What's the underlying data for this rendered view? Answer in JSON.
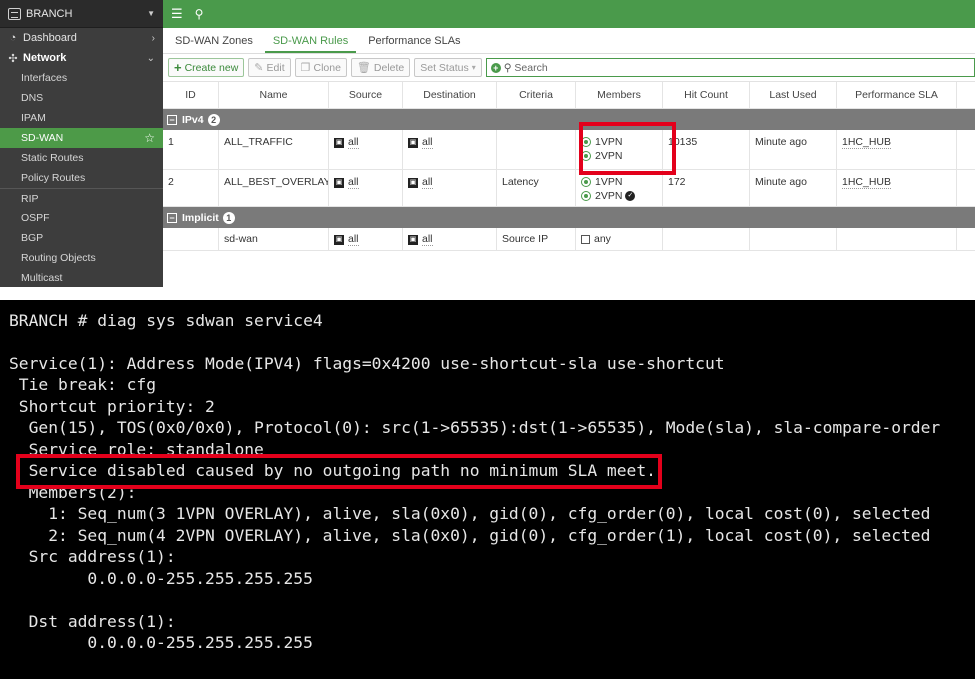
{
  "sidebar": {
    "device": "BRANCH",
    "items": [
      {
        "icon": "dashboard-icon",
        "label": "Dashboard"
      },
      {
        "icon": "network-icon",
        "label": "Network"
      }
    ],
    "network_sub": [
      "Interfaces",
      "DNS",
      "IPAM",
      "SD-WAN",
      "Static Routes",
      "Policy Routes",
      "RIP",
      "OSPF",
      "BGP",
      "Routing Objects",
      "Multicast"
    ]
  },
  "tabs": [
    "SD-WAN Zones",
    "SD-WAN Rules",
    "Performance SLAs"
  ],
  "toolbar": {
    "create": "Create new",
    "edit": "Edit",
    "clone": "Clone",
    "delete": "Delete",
    "set_status": "Set Status",
    "search_placeholder": "Search"
  },
  "table": {
    "headers": [
      "ID",
      "Name",
      "Source",
      "Destination",
      "Criteria",
      "Members",
      "Hit Count",
      "Last Used",
      "Performance SLA"
    ],
    "groups": [
      {
        "label": "IPv4",
        "count": "2"
      },
      {
        "label": "Implicit",
        "count": "1"
      }
    ],
    "rows": [
      {
        "id": "1",
        "name": "ALL_TRAFFIC",
        "source": "all",
        "destination": "all",
        "criteria": "",
        "members": [
          "1VPN",
          "2VPN"
        ],
        "hit": "10135",
        "last": "Minute ago",
        "sla": "1HC_HUB"
      },
      {
        "id": "2",
        "name": "ALL_BEST_OVERLAY",
        "source": "all",
        "destination": "all",
        "criteria": "Latency",
        "members": [
          "1VPN",
          "2VPN"
        ],
        "hit": "172",
        "last": "Minute ago",
        "sla": "1HC_HUB"
      },
      {
        "id": "",
        "name": "sd-wan",
        "source": "all",
        "destination": "all",
        "criteria": "Source IP",
        "members": [
          "any"
        ],
        "hit": "",
        "last": "",
        "sla": ""
      }
    ]
  },
  "terminal": {
    "lines": [
      "BRANCH # diag sys sdwan service4",
      "",
      "Service(1): Address Mode(IPV4) flags=0x4200 use-shortcut-sla use-shortcut",
      " Tie break: cfg",
      " Shortcut priority: 2",
      "  Gen(15), TOS(0x0/0x0), Protocol(0): src(1->65535):dst(1->65535), Mode(sla), sla-compare-order",
      "  Service role: standalone",
      "  Service disabled caused by no outgoing path no minimum SLA meet.",
      "  Members(2):",
      "    1: Seq_num(3 1VPN OVERLAY), alive, sla(0x0), gid(0), cfg_order(0), local cost(0), selected",
      "    2: Seq_num(4 2VPN OVERLAY), alive, sla(0x0), gid(0), cfg_order(1), local cost(0), selected",
      "  Src address(1):",
      "        0.0.0.0-255.255.255.255",
      "",
      "  Dst address(1):",
      "        0.0.0.0-255.255.255.255"
    ]
  },
  "colors": {
    "accent": "#4a9a4b",
    "highlight": "#e3001b",
    "sidebar": "#3d3d3d"
  }
}
